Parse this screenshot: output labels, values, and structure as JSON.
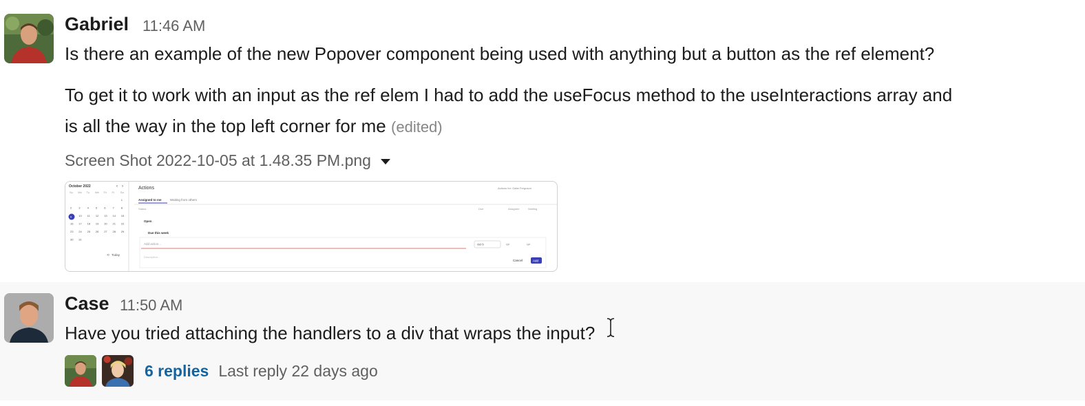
{
  "message1": {
    "author": "Gabriel",
    "time": "11:46 AM",
    "line1": "Is there an example of the new Popover component being used with anything but a button as the ref element?",
    "line2": "To get it to work with an input as the ref elem I had to add the useFocus method to the useInteractions array and",
    "line3": "is all the way in the top left corner for me",
    "edited": "(edited)",
    "attachment": {
      "filename": "Screen Shot 2022-10-05 at 1.48.35 PM.png",
      "icon": "caret-down-icon",
      "preview": {
        "calendar_month": "October 2022",
        "weekdays": [
          "Su",
          "Mo",
          "Tu",
          "We",
          "Th",
          "Fr",
          "Sa"
        ],
        "today_label": "Today",
        "title": "Actions",
        "actions_for": "Actions for: Gabe Ferguson",
        "tabs": [
          "Assigned to me",
          "Waiting from others"
        ],
        "columns": [
          "Status",
          "Due",
          "Assignee",
          "Waiting"
        ],
        "group": "Open",
        "subgroup": "Due this week",
        "input_placeholder": "Add action...",
        "due_value": "Oct 5",
        "assignee_value": "GF",
        "waiting_value": "GF",
        "description_placeholder": "Description...",
        "cancel": "Cancel",
        "add": "Add"
      }
    }
  },
  "message2": {
    "author": "Case",
    "time": "11:50 AM",
    "text": "Have you tried attaching the handlers to a div that wraps the input?",
    "thread": {
      "count": "6 replies",
      "last_reply": "Last reply 22 days ago"
    }
  },
  "colors": {
    "link": "#1264a3",
    "accent": "#3b3fb6",
    "hover_bg": "#f8f8f8"
  }
}
